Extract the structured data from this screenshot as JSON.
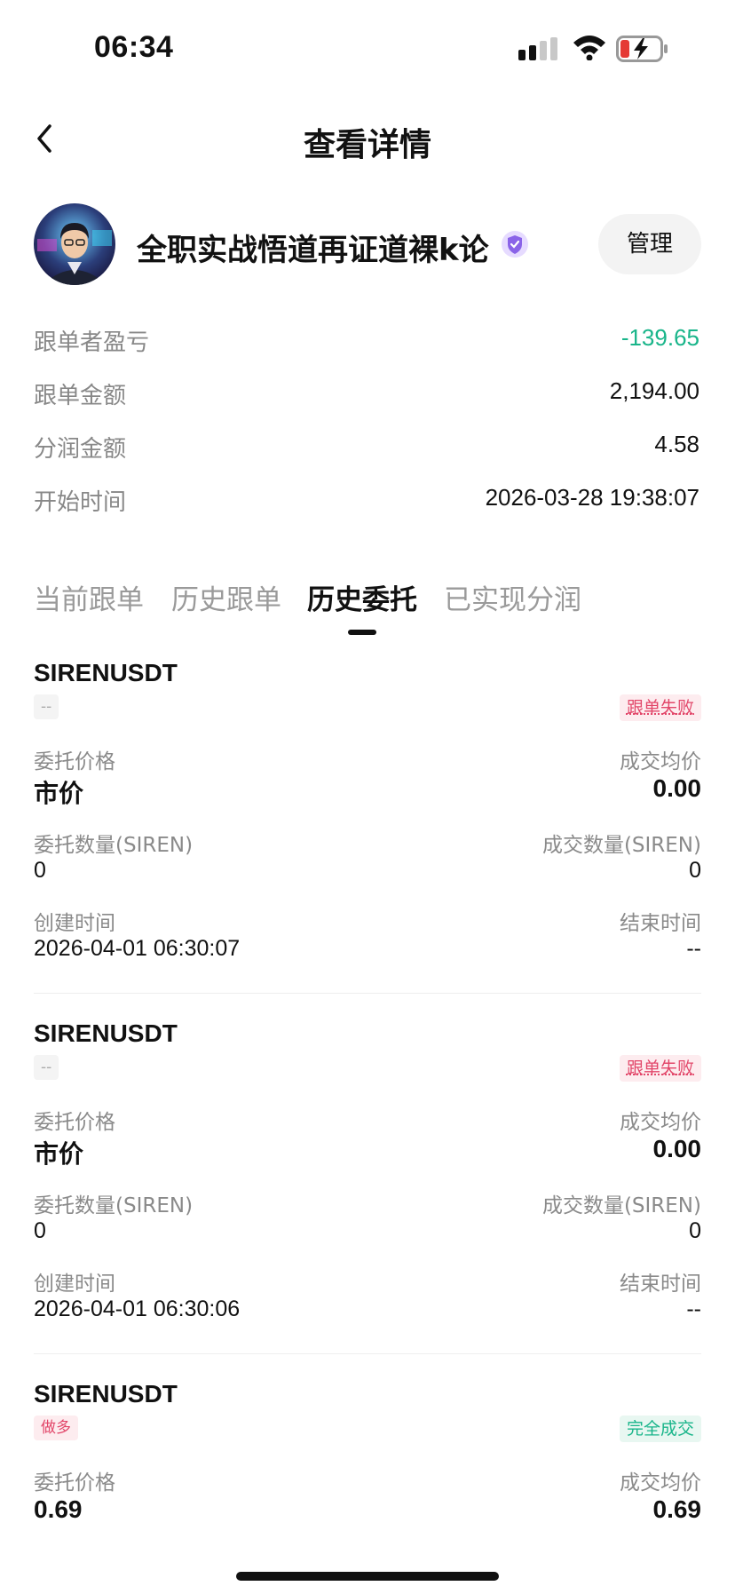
{
  "status_bar": {
    "time": "06:34",
    "icons": [
      "signal-icon",
      "wifi-icon",
      "battery-charging-icon"
    ]
  },
  "nav": {
    "back_icon": "chevron-left-icon",
    "title": "查看详情"
  },
  "trader": {
    "name": "全职实战悟道再证道裸k论",
    "badge_icon": "shield-badge-icon",
    "manage_label": "管理"
  },
  "stats": [
    {
      "label": "跟单者盈亏",
      "value": "-139.65"
    },
    {
      "label": "跟单金额",
      "value": "2,194.00"
    },
    {
      "label": "分润金额",
      "value": "4.58"
    },
    {
      "label": "开始时间",
      "value": "2026-03-28 19:38:07"
    }
  ],
  "tabs": [
    {
      "label": "当前跟单",
      "active": false
    },
    {
      "label": "历史跟单",
      "active": false
    },
    {
      "label": "历史委托",
      "active": true
    },
    {
      "label": "已实现分润",
      "active": false
    }
  ],
  "orders": [
    {
      "symbol": "SIRENUSDT",
      "side": "--",
      "status": "跟单失败",
      "price_label": "委托价格",
      "price": "市价",
      "avg_label": "成交均价",
      "avg": "0.00",
      "qty_label": "委托数量(SIREN)",
      "qty": "0",
      "filled_label": "成交数量(SIREN)",
      "filled": "0",
      "created_label": "创建时间",
      "created": "2026-04-01 06:30:07",
      "ended_label": "结束时间",
      "ended": "--"
    },
    {
      "symbol": "SIRENUSDT",
      "side": "--",
      "status": "跟单失败",
      "price_label": "委托价格",
      "price": "市价",
      "avg_label": "成交均价",
      "avg": "0.00",
      "qty_label": "委托数量(SIREN)",
      "qty": "0",
      "filled_label": "成交数量(SIREN)",
      "filled": "0",
      "created_label": "创建时间",
      "created": "2026-04-01 06:30:06",
      "ended_label": "结束时间",
      "ended": "--"
    },
    {
      "symbol": "SIRENUSDT",
      "side": "做多",
      "status": "完全成交",
      "price_label": "委托价格",
      "price": "0.69",
      "avg_label": "成交均价",
      "avg": "0.69"
    }
  ],
  "colors": {
    "positive_green": "#19b58a",
    "fail_red": "#e2476a",
    "label_gray": "#8a8a8a"
  }
}
